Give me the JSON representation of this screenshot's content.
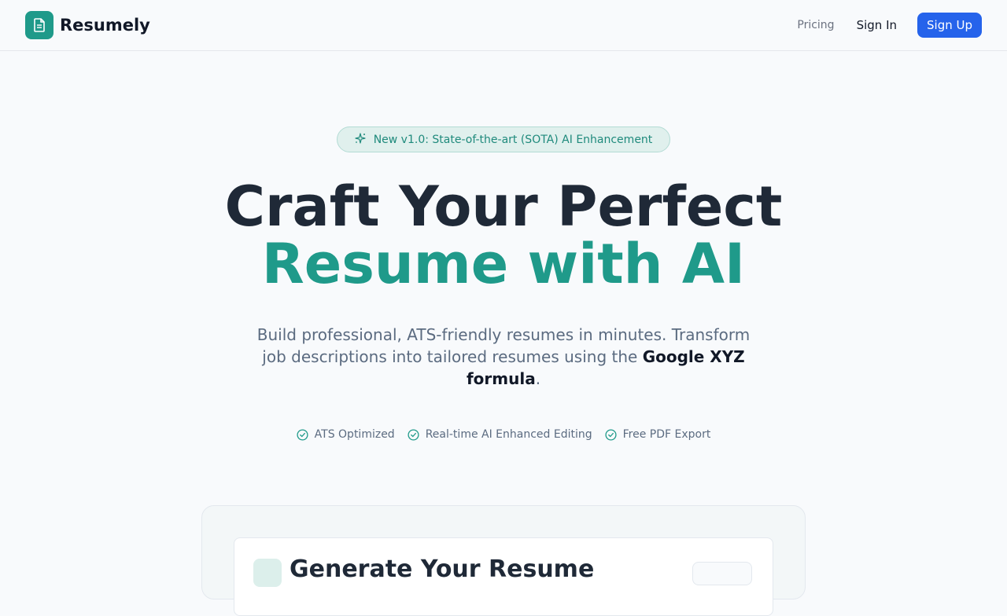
{
  "navbar": {
    "brand": "Resumely",
    "links": {
      "pricing": "Pricing",
      "sign_in": "Sign In",
      "sign_up": "Sign Up"
    }
  },
  "hero": {
    "badge": "New v1.0: State-of-the-art (SOTA) AI Enhancement",
    "headline_line1": "Craft Your Perfect",
    "headline_line2": "Resume with AI",
    "subtitle_before": "Build professional, ATS-friendly resumes in minutes. Transform job descriptions into tailored resumes using the ",
    "subtitle_emphasis": "Google XYZ formula",
    "subtitle_after": ".",
    "features": [
      "ATS Optimized",
      "Real-time AI Enhanced Editing",
      "Free PDF Export"
    ]
  },
  "preview": {
    "title": "Generate Your Resume"
  },
  "colors": {
    "accent": "#1f9a8a",
    "primary_button": "#2563eb",
    "heading": "#1f2937"
  },
  "icons": {
    "logo": "document-icon",
    "badge": "sparkles-icon",
    "feature": "check-circle-icon"
  }
}
